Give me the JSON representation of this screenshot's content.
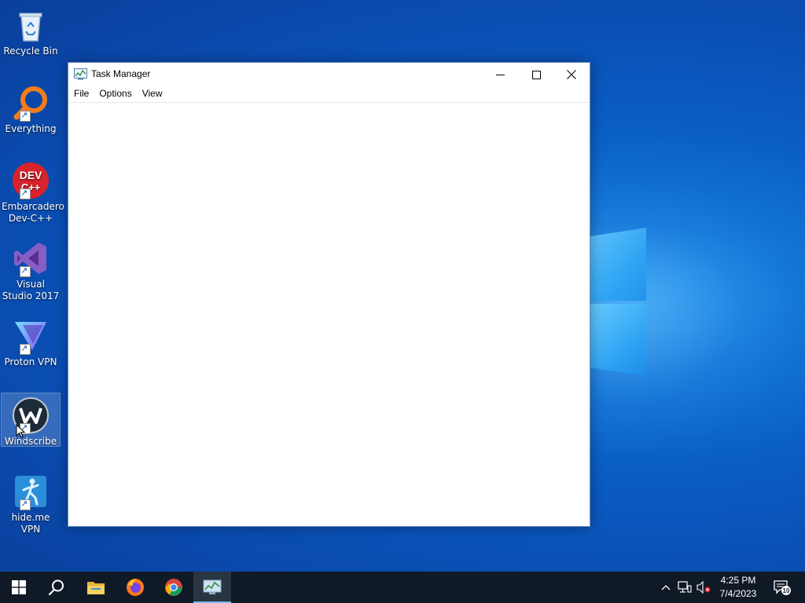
{
  "desktop": {
    "icons": [
      {
        "label": "Recycle Bin"
      },
      {
        "label": "Everything"
      },
      {
        "label": "Embarcadero Dev-C++"
      },
      {
        "label": "Visual Studio 2017"
      },
      {
        "label": "Proton VPN"
      },
      {
        "label": "Windscribe"
      },
      {
        "label": "hide.me VPN"
      }
    ],
    "devcpp_icon_text_1": "DEV",
    "devcpp_icon_text_2": "C++"
  },
  "window": {
    "title": "Task Manager",
    "menu": [
      "File",
      "Options",
      "View"
    ]
  },
  "taskbar": {
    "time": "4:25 PM",
    "date": "7/4/2023",
    "notification_count": "10"
  },
  "colors": {
    "desktop_blue": "#0a5ec6",
    "taskbar": "#101a26",
    "active_indicator": "#76b9ed"
  }
}
